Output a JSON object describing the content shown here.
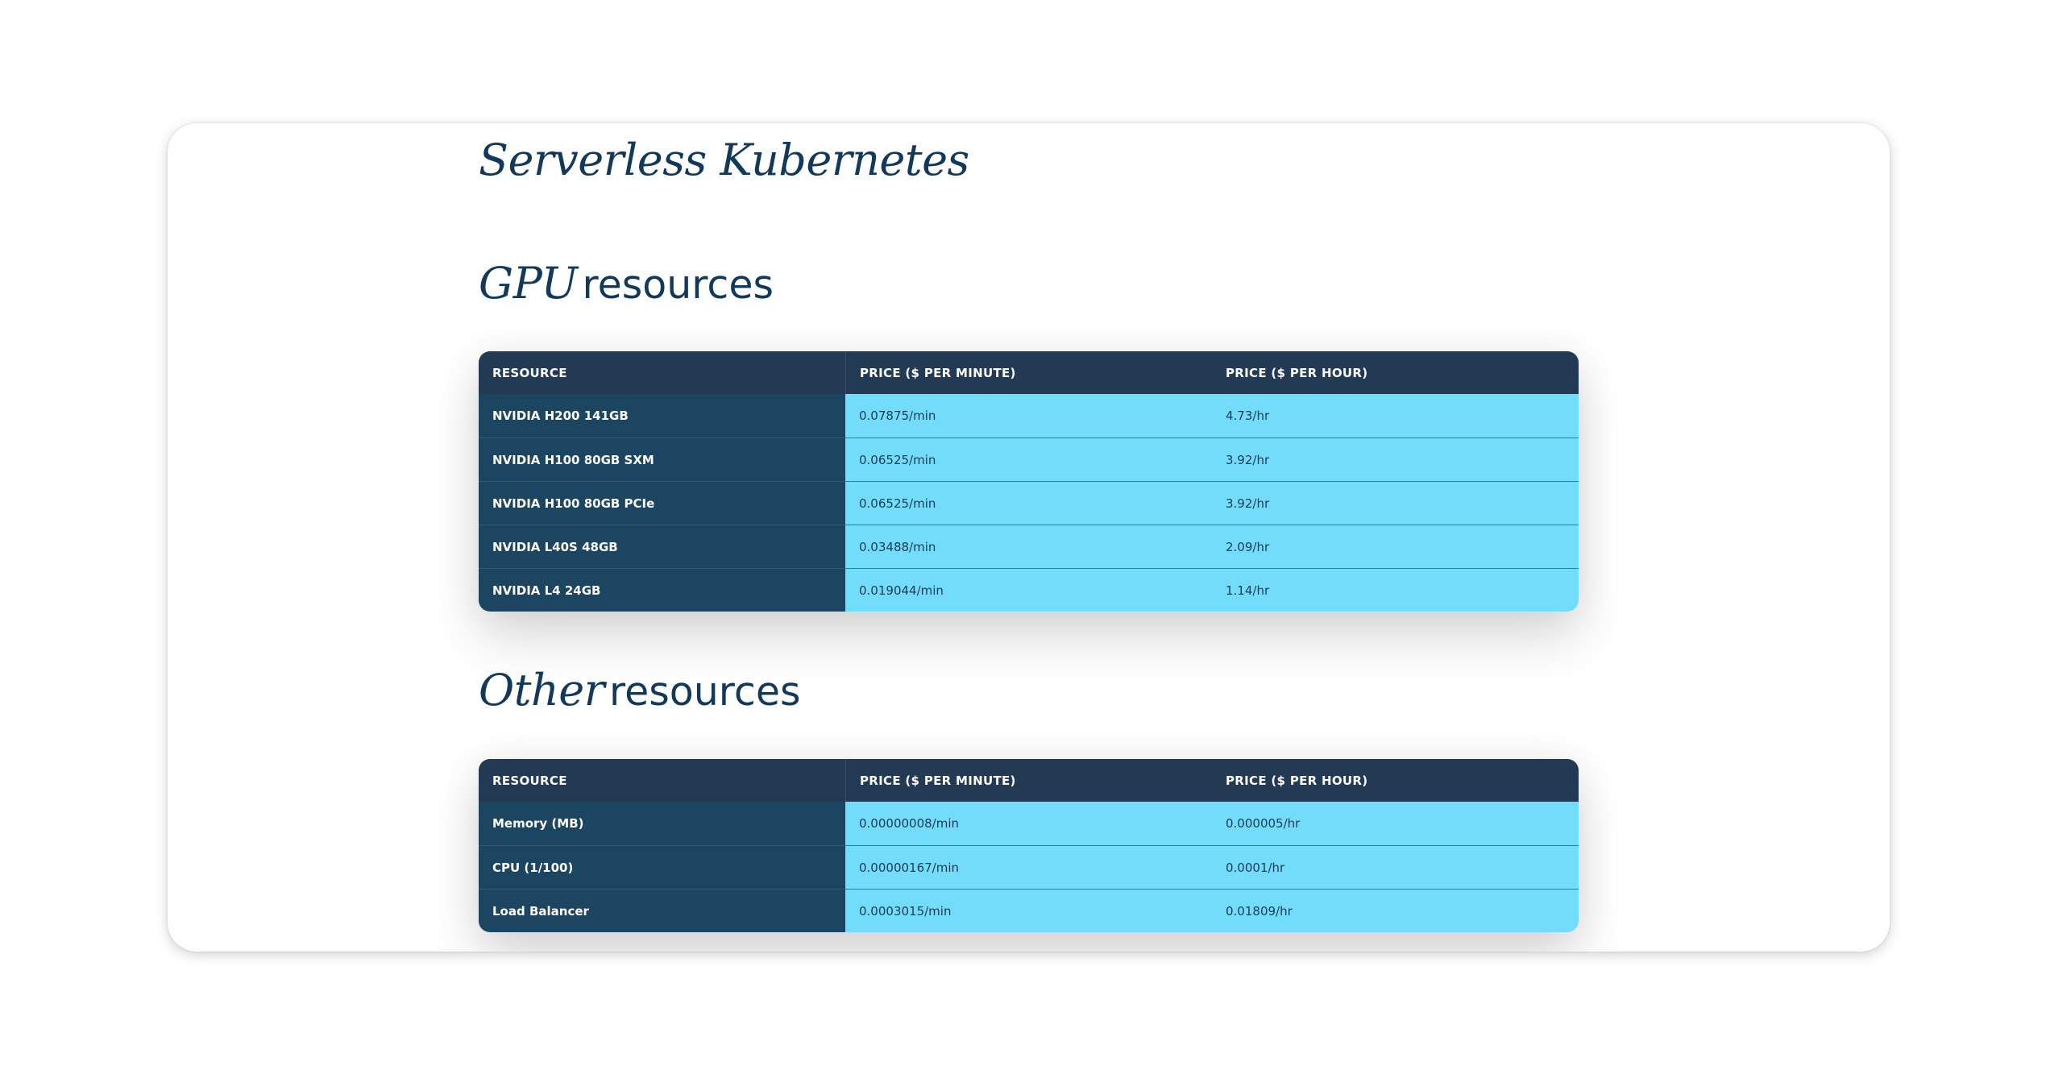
{
  "page_title": "Serverless Kubernetes",
  "gpu_section": {
    "title_em": "GPU",
    "title_rest": "resources",
    "columns": [
      "RESOURCE",
      "PRICE ($ PER MINUTE)",
      "PRICE ($ PER HOUR)"
    ],
    "rows": [
      {
        "resource": "NVIDIA H200 141GB",
        "per_minute": "0.07875/min",
        "per_hour": "4.73/hr"
      },
      {
        "resource": "NVIDIA H100 80GB SXM",
        "per_minute": "0.06525/min",
        "per_hour": "3.92/hr"
      },
      {
        "resource": "NVIDIA H100 80GB PCIe",
        "per_minute": "0.06525/min",
        "per_hour": "3.92/hr"
      },
      {
        "resource": "NVIDIA L40S 48GB",
        "per_minute": "0.03488/min",
        "per_hour": "2.09/hr"
      },
      {
        "resource": "NVIDIA L4 24GB",
        "per_minute": "0.019044/min",
        "per_hour": "1.14/hr"
      }
    ]
  },
  "other_section": {
    "title_em": "Other",
    "title_rest": "resources",
    "columns": [
      "RESOURCE",
      "PRICE ($ PER MINUTE)",
      "PRICE ($ PER HOUR)"
    ],
    "rows": [
      {
        "resource": "Memory (MB)",
        "per_minute": "0.00000008/min",
        "per_hour": "0.000005/hr"
      },
      {
        "resource": "CPU (1/100)",
        "per_minute": "0.00000167/min",
        "per_hour": "0.0001/hr"
      },
      {
        "resource": "Load Balancer",
        "per_minute": "0.0003015/min",
        "per_hour": "0.01809/hr"
      }
    ]
  },
  "colors": {
    "title": "#12385a",
    "header_bg": "#223a53",
    "resource_cell_bg": "#1c4561",
    "price_cell_bg": "#74dcfb"
  }
}
